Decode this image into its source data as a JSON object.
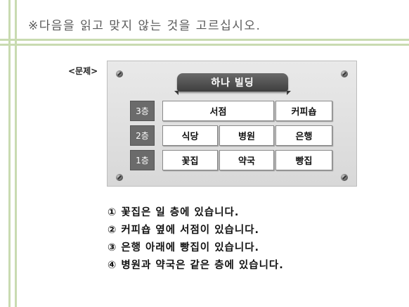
{
  "instruction": "※다음을 읽고 맞지 않는 것을 고르십시오.",
  "problem_label": "<문제>",
  "building": {
    "name": "하나 빌딩",
    "floors": [
      {
        "label": "3층",
        "rooms": [
          "서점",
          "커피숍"
        ]
      },
      {
        "label": "2층",
        "rooms": [
          "식당",
          "병원",
          "은행"
        ]
      },
      {
        "label": "1층",
        "rooms": [
          "꽃집",
          "약국",
          "빵집"
        ]
      }
    ]
  },
  "statements": [
    "① 꽃집은 일 층에 있습니다.",
    "② 커피숍 옆에 서점이 있습니다.",
    "③ 은행 아래에 빵집이 있습니다.",
    "④ 병원과 약국은 같은 층에 있습니다."
  ]
}
